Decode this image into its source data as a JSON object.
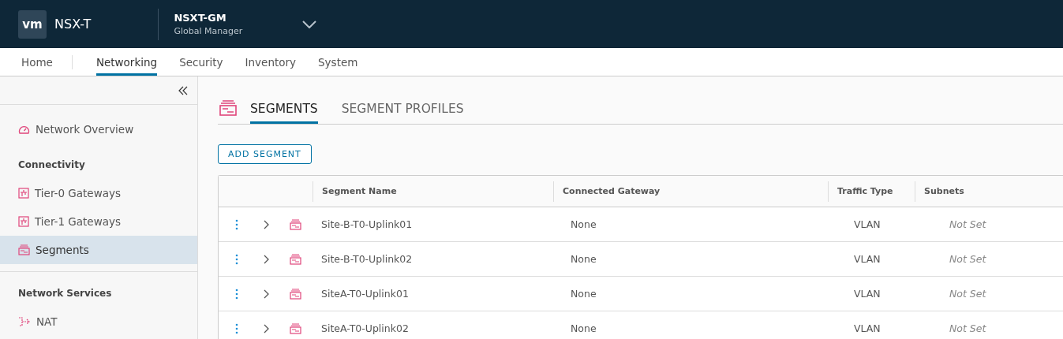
{
  "header": {
    "logo": "vm",
    "product": "NSX-T",
    "manager_name": "NSXT-GM",
    "manager_role": "Global Manager"
  },
  "nav_tabs": [
    {
      "label": "Home",
      "selected": false
    },
    {
      "label": "Networking",
      "selected": true
    },
    {
      "label": "Security",
      "selected": false
    },
    {
      "label": "Inventory",
      "selected": false
    },
    {
      "label": "System",
      "selected": false
    }
  ],
  "sidebar": {
    "items": [
      {
        "kind": "overview",
        "label": "Network Overview",
        "selected": false
      },
      {
        "kind": "header",
        "label": "Connectivity"
      },
      {
        "kind": "gateway",
        "label": "Tier-0 Gateways",
        "selected": false
      },
      {
        "kind": "gateway",
        "label": "Tier-1 Gateways",
        "selected": false
      },
      {
        "kind": "segment",
        "label": "Segments",
        "selected": true
      },
      {
        "kind": "divider"
      },
      {
        "kind": "header",
        "label": "Network Services"
      },
      {
        "kind": "nat",
        "label": "NAT",
        "selected": false
      }
    ]
  },
  "page_tabs": [
    {
      "label": "SEGMENTS",
      "selected": true
    },
    {
      "label": "SEGMENT PROFILES",
      "selected": false
    }
  ],
  "add_button": "ADD SEGMENT",
  "table": {
    "columns": [
      "Segment Name",
      "Connected Gateway",
      "Traffic Type",
      "Subnets"
    ],
    "rows": [
      {
        "name": "Site-B-T0-Uplink01",
        "gateway": "None",
        "traffic": "VLAN",
        "subnets": "Not Set"
      },
      {
        "name": "Site-B-T0-Uplink02",
        "gateway": "None",
        "traffic": "VLAN",
        "subnets": "Not Set"
      },
      {
        "name": "SiteA-T0-Uplink01",
        "gateway": "None",
        "traffic": "VLAN",
        "subnets": "Not Set"
      },
      {
        "name": "SiteA-T0-Uplink02",
        "gateway": "None",
        "traffic": "VLAN",
        "subnets": "Not Set"
      }
    ]
  }
}
